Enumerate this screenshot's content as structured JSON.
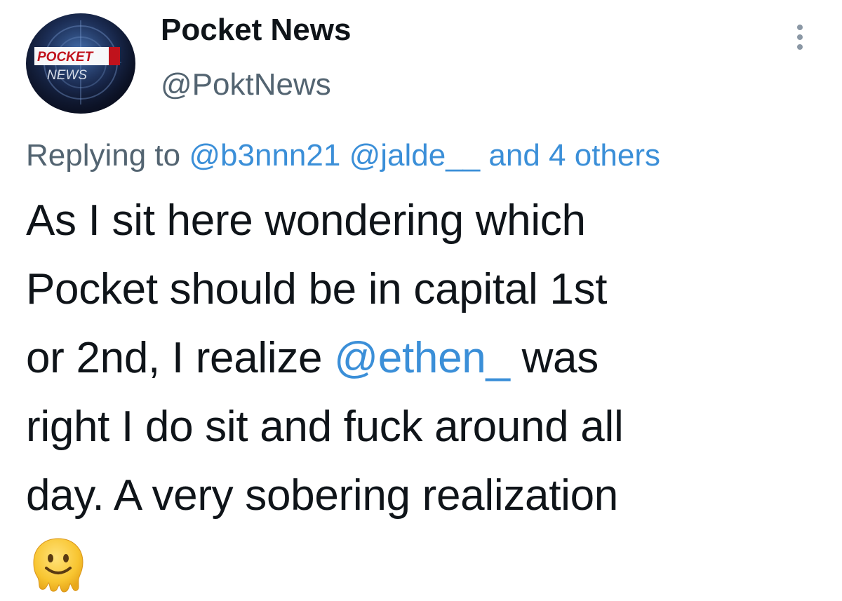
{
  "author": {
    "display_name": "Pocket News",
    "handle": "@PoktNews",
    "avatar_text_top": "POCKET",
    "avatar_text_bottom": "NEWS"
  },
  "reply": {
    "prefix": "Replying to",
    "mention_1": "@b3nnn21",
    "mention_2": "@jalde__",
    "others": "and 4 others"
  },
  "tweet": {
    "line_1": "As I sit here wondering which",
    "line_2": "Pocket should be in capital 1st",
    "line_3_before": "or 2nd, I realize ",
    "line_3_mention": "@ethen_",
    "line_3_after": " was",
    "line_4": "right I do sit and fuck around all",
    "line_5": "day.  A very sobering realization",
    "emoji": "melting-face-emoji"
  },
  "colors": {
    "link": "#3b8fd8",
    "text": "#0f1419",
    "muted": "#536471"
  },
  "icons": {
    "more": "more-dots-vertical-icon"
  }
}
